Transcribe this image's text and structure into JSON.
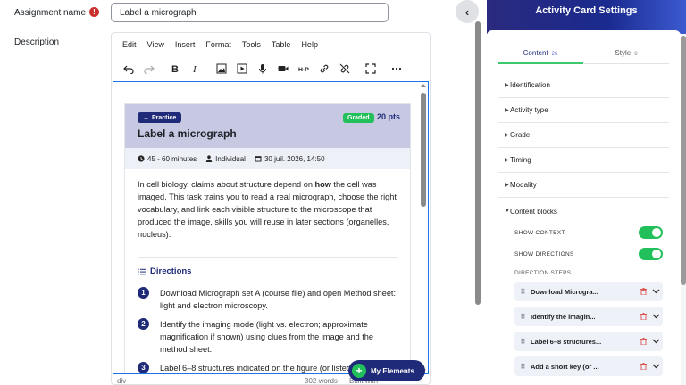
{
  "form": {
    "name_label": "Assignment name",
    "name_value": "Label a micrograph",
    "desc_label": "Description"
  },
  "editor": {
    "menu": [
      "Edit",
      "View",
      "Insert",
      "Format",
      "Tools",
      "Table",
      "Help"
    ],
    "toolbar_icons": [
      "undo-icon",
      "redo-icon",
      "bold-icon",
      "italic-icon",
      "image-icon",
      "media-icon",
      "microphone-icon",
      "video-icon",
      "h5p-icon",
      "link-icon",
      "unlink-icon",
      "fullscreen-icon",
      "more-icon"
    ],
    "status_path": "div",
    "word_count": "302 words",
    "built_with": "Built with",
    "colors": {
      "focus_border": "#1a73e8"
    }
  },
  "card": {
    "practice_badge": "Practice",
    "graded_badge": "Graded",
    "points": "20 pts",
    "title": "Label a micrograph",
    "meta_time": "45 - 60 minutes",
    "meta_mode": "Individual",
    "meta_date": "30 juil. 2026, 14:50",
    "desc_before": "In cell biology, claims about structure depend on ",
    "desc_bold": "how",
    "desc_after": " the cell was imaged. This task trains you to read a real micrograph, choose the right vocabulary, and link each visible structure to the microscope that produced the image, skills you will reuse in later sections (organelles, nucleus).",
    "directions_title": "Directions",
    "steps": [
      {
        "n": "1",
        "text": "Download Micrograph set A (course file) and open Method sheet: light and electron microscopy."
      },
      {
        "n": "2",
        "text": "Identify the imaging mode (light vs. electron; approximate magnification if shown) using clues from the image and the method sheet."
      },
      {
        "n": "3",
        "text": "Label 6–8 structures indicated on the figure (or listed"
      }
    ],
    "colors": {
      "header_bg": "#c7c9e3",
      "brand": "#1f2a78",
      "graded": "#22c05a"
    }
  },
  "fab": {
    "label": "My Elements",
    "plus": "+"
  },
  "drawer": {
    "toggle": "‹"
  },
  "panel": {
    "title": "Activity Card Settings",
    "tabs": [
      {
        "label": "Content",
        "count": "26"
      },
      {
        "label": "Style",
        "count": "8"
      }
    ],
    "sections": [
      {
        "label": "Identification",
        "arrow": "▶"
      },
      {
        "label": "Activity type",
        "arrow": "▶"
      },
      {
        "label": "Grade",
        "arrow": "▶"
      },
      {
        "label": "Timing",
        "arrow": "▶"
      },
      {
        "label": "Modality",
        "arrow": "▶"
      },
      {
        "label": "Content blocks",
        "arrow": "▼"
      }
    ],
    "show_context": "SHOW CONTEXT",
    "show_directions": "SHOW DIRECTIONS",
    "steps_label": "DIRECTION STEPS",
    "step_items": [
      "Download Microgra...",
      "Identify the imagin...",
      "Label 6–8 structures...",
      "Add a short key (or ..."
    ],
    "colors": {
      "head_from": "#2a2a7e",
      "head_to": "#3c5ad0",
      "tab_accent": "#3ec76b",
      "switch_on": "#22c05a"
    }
  }
}
